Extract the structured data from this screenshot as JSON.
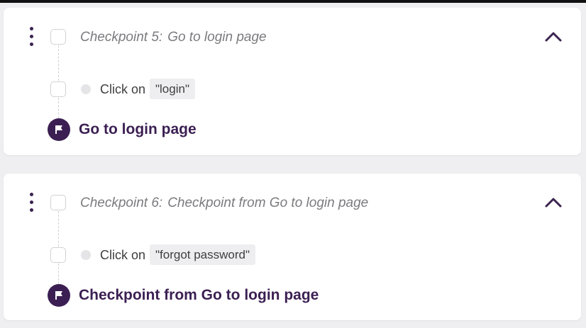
{
  "checkpoints": [
    {
      "label": "Checkpoint 5:",
      "name": "Go to login page",
      "steps": [
        {
          "action": "Click on",
          "target": "\"login\""
        }
      ],
      "result": "Go to login page"
    },
    {
      "label": "Checkpoint 6:",
      "name": "Checkpoint from Go to login page",
      "steps": [
        {
          "action": "Click on",
          "target": "\"forgot password\""
        }
      ],
      "result": "Checkpoint from Go to login page"
    }
  ],
  "icons": {
    "menu": "vertical-dots-icon",
    "collapse": "chevron-up-icon",
    "result": "flag-icon",
    "step_status": "status-dot-icon"
  },
  "colors": {
    "accent": "#3b1f52",
    "muted_text": "#7b7b7f",
    "chip_bg": "#eeeef0",
    "page_bg": "#efeff1"
  }
}
